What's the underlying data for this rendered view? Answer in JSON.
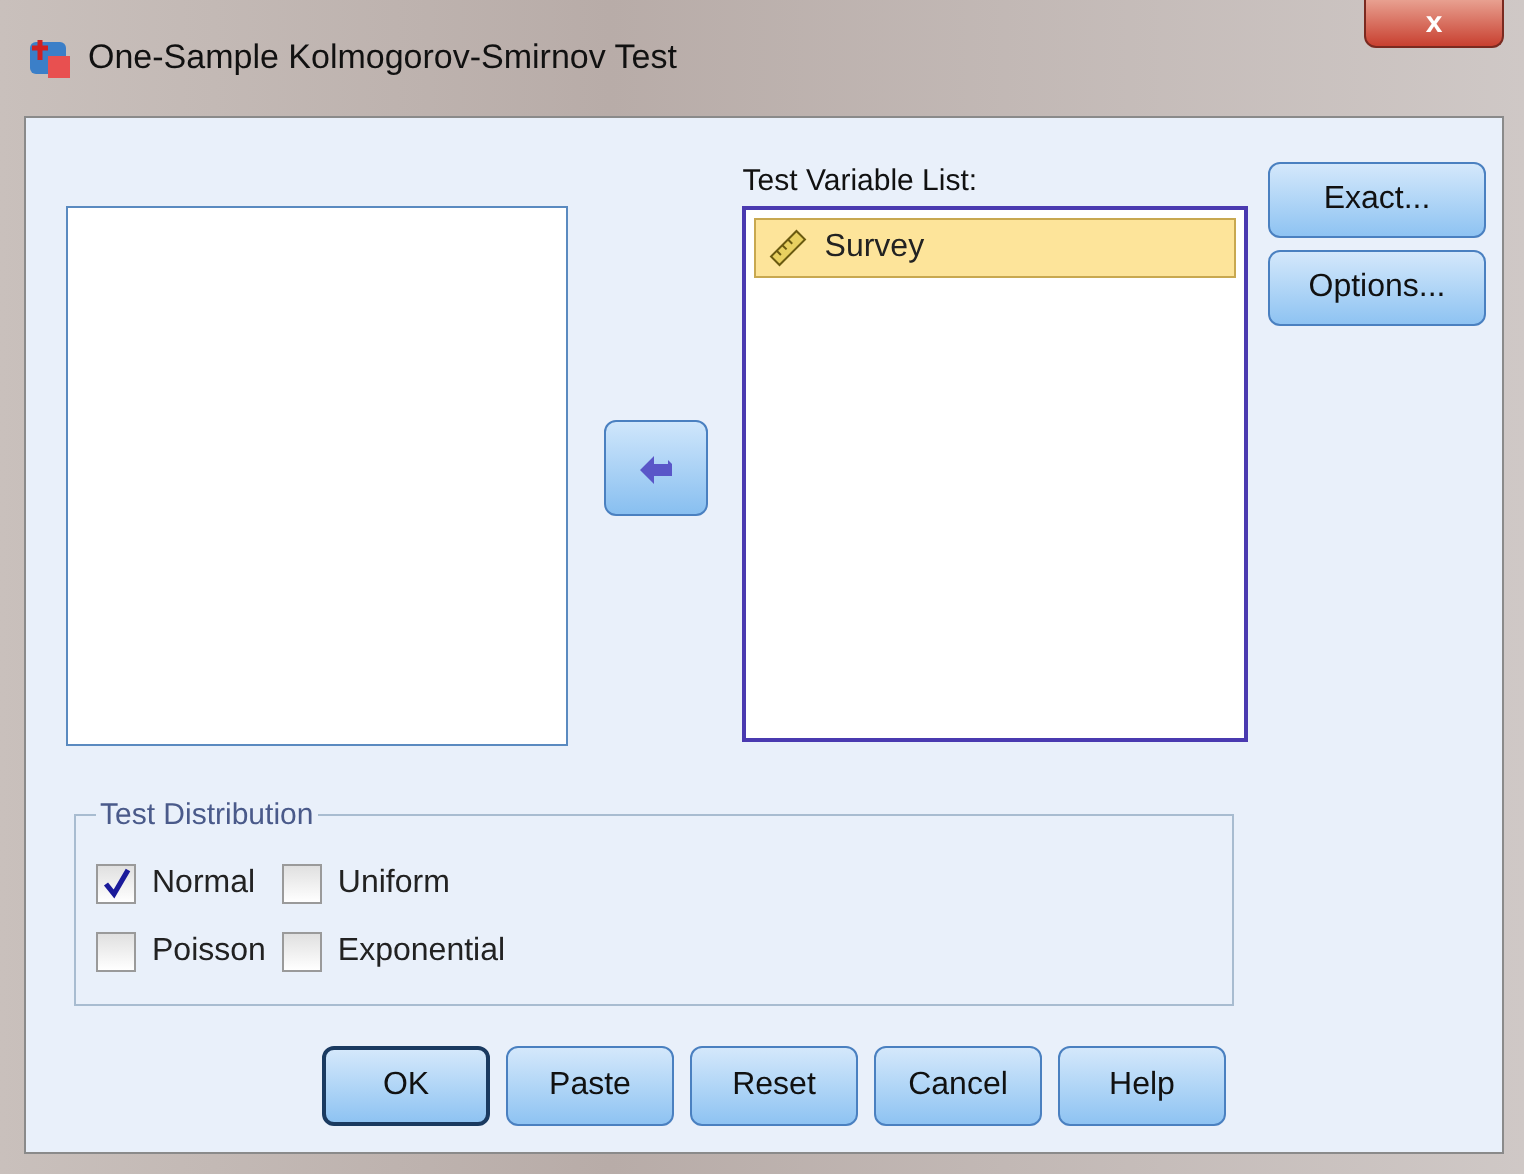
{
  "window": {
    "title": "One-Sample Kolmogorov-Smirnov Test",
    "close": "x"
  },
  "test_variable_list": {
    "label": "Test Variable List:",
    "items": [
      {
        "label": "Survey",
        "selected": true
      }
    ]
  },
  "side_buttons": [
    "Exact...",
    "Options..."
  ],
  "test_distribution": {
    "title": "Test Distribution",
    "options": [
      {
        "label": "Normal",
        "checked": true
      },
      {
        "label": "Uniform",
        "checked": false
      },
      {
        "label": "Poisson",
        "checked": false
      },
      {
        "label": "Exponential",
        "checked": false
      }
    ]
  },
  "buttons": [
    {
      "label": "OK",
      "default": true
    },
    {
      "label": "Paste",
      "default": false
    },
    {
      "label": "Reset",
      "default": false
    },
    {
      "label": "Cancel",
      "default": false
    },
    {
      "label": "Help",
      "default": false
    }
  ]
}
